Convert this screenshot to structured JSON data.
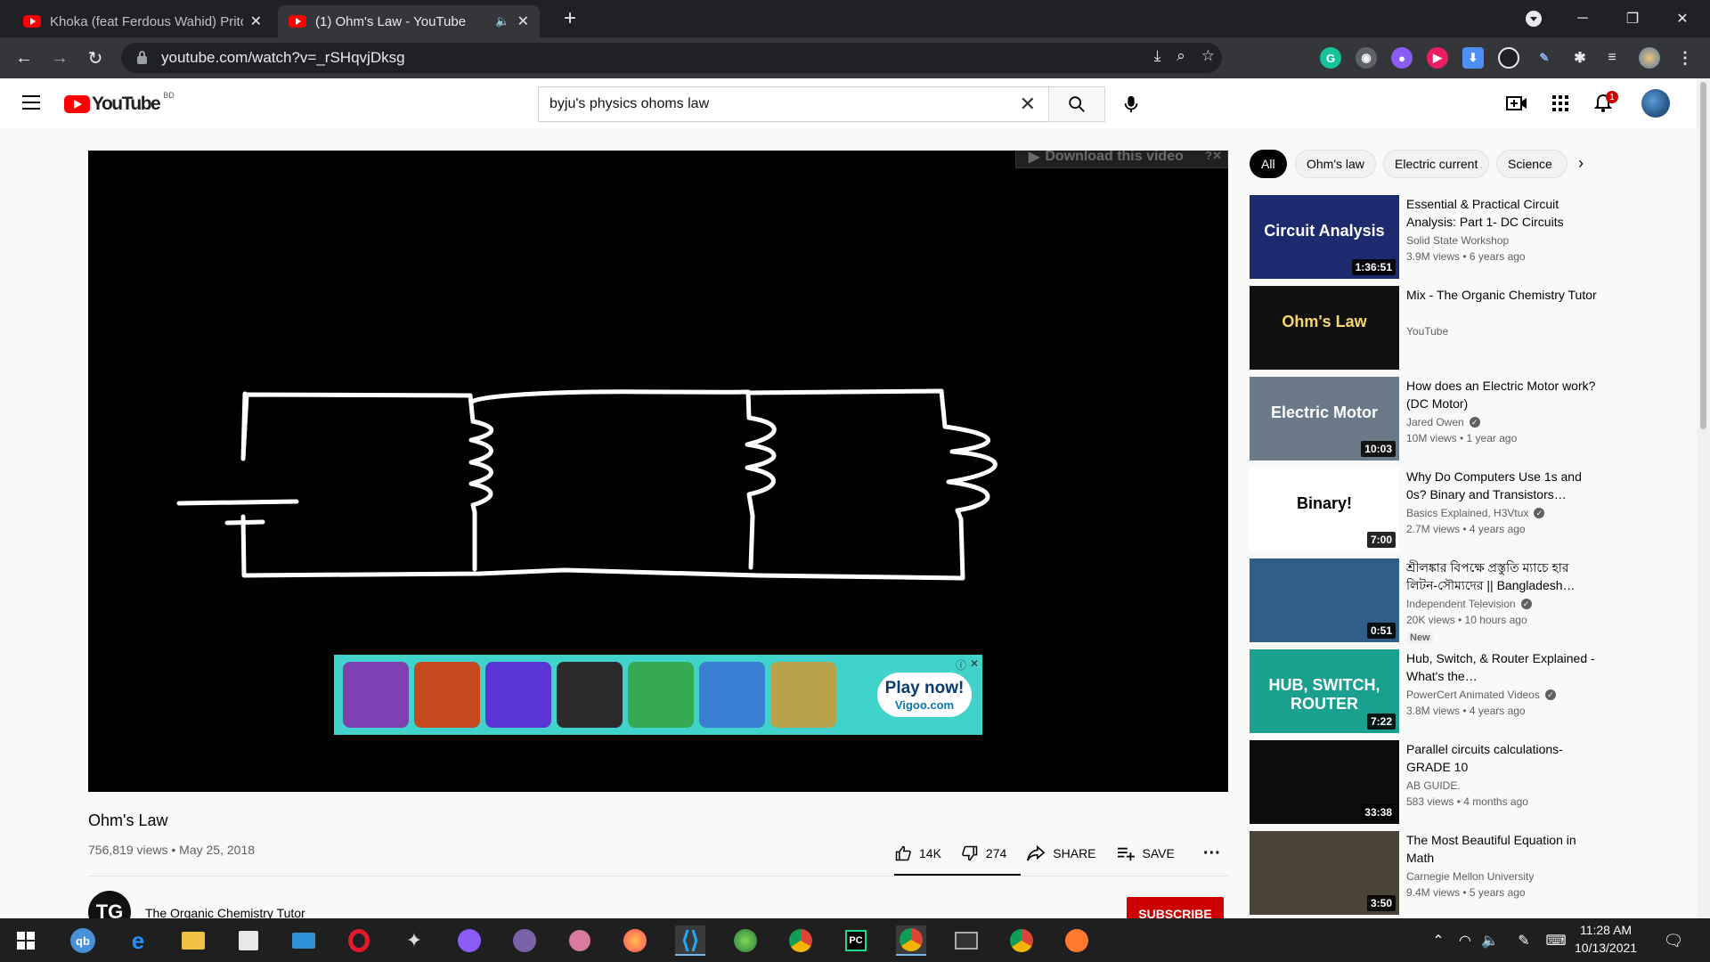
{
  "browser": {
    "tabs": [
      {
        "title": "Khoka (feat Ferdous Wahid) Prito",
        "active": false
      },
      {
        "title": "(1) Ohm's Law - YouTube",
        "active": true
      }
    ],
    "url": "youtube.com/watch?v=_rSHqvjDksg"
  },
  "youtube": {
    "logo_text": "YouTube",
    "country_code": "BD",
    "search_query": "byju's physics ohoms law",
    "notification_count": "1"
  },
  "player": {
    "download_bar_label": "Download this video",
    "ad": {
      "cta_line1": "Play now!",
      "cta_line2": "Vigoo.com",
      "tiles": [
        "#7e3fb0",
        "#c44a1d",
        "#5b34d6",
        "#2b2b2b",
        "#34a853",
        "#3b7fd4",
        "#b8a24a"
      ]
    }
  },
  "video": {
    "title": "Ohm's Law",
    "views_date": "756,819 views • May 25, 2018",
    "likes": "14K",
    "dislikes": "274",
    "share_label": "SHARE",
    "save_label": "SAVE",
    "channel_initials": "TG",
    "channel_name": "The Organic Chemistry Tutor",
    "subscribe_label": "SUBSCRIBE"
  },
  "chips": [
    "All",
    "Ohm's law",
    "Electric current",
    "Science"
  ],
  "recommendations": [
    {
      "title": "Essential & Practical Circuit Analysis: Part 1- DC Circuits",
      "channel": "Solid State Workshop",
      "verified": false,
      "stats": "3.9M views • 6 years ago",
      "duration": "1:36:51",
      "thumb_bg": "#1c2a6e",
      "thumb_text": "Circuit Analysis"
    },
    {
      "title": "Mix - The Organic Chemistry Tutor",
      "channel": "YouTube",
      "verified": false,
      "stats": "",
      "duration": "",
      "thumb_bg": "#101010",
      "thumb_text": "Ohm's Law"
    },
    {
      "title": "How does an Electric Motor work? (DC Motor)",
      "channel": "Jared Owen",
      "verified": true,
      "stats": "10M views • 1 year ago",
      "duration": "10:03",
      "thumb_bg": "#6b7a88",
      "thumb_text": "Electric Motor"
    },
    {
      "title": "Why Do Computers Use 1s and 0s? Binary and Transistors…",
      "channel": "Basics Explained, H3Vtux",
      "verified": true,
      "stats": "2.7M views • 4 years ago",
      "duration": "7:00",
      "thumb_bg": "#ffffff",
      "thumb_text": "Binary!"
    },
    {
      "title": "শ্রীলঙ্কার বিপক্ষে প্রস্তুতি ম্যাচে হার লিটন-সৌম্যদের || Bangladesh…",
      "channel": "Independent Television",
      "verified": true,
      "stats": "20K views • 10 hours ago",
      "duration": "0:51",
      "thumb_bg": "#2f5e88",
      "thumb_text": "",
      "badge": "New"
    },
    {
      "title": "Hub, Switch, & Router Explained - What's the…",
      "channel": "PowerCert Animated Videos",
      "verified": true,
      "stats": "3.8M views • 4 years ago",
      "duration": "7:22",
      "thumb_bg": "#1aa08e",
      "thumb_text": "HUB, SWITCH, ROUTER"
    },
    {
      "title": "Parallel circuits calculations- GRADE 10",
      "channel": "AB GUIDE.",
      "verified": false,
      "stats": "583 views • 4 months ago",
      "duration": "33:38",
      "thumb_bg": "#0d0d0d",
      "thumb_text": ""
    },
    {
      "title": "The Most Beautiful Equation in Math",
      "channel": "Carnegie Mellon University",
      "verified": false,
      "stats": "9.4M views • 5 years ago",
      "duration": "3:50",
      "thumb_bg": "#4a4438",
      "thumb_text": ""
    }
  ],
  "taskbar": {
    "time": "11:28 AM",
    "date": "10/13/2021"
  }
}
